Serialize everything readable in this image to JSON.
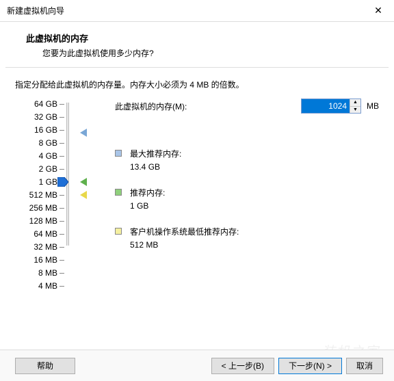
{
  "window": {
    "title": "新建虚拟机向导"
  },
  "header": {
    "title": "此虚拟机的内存",
    "subtitle": "您要为此虚拟机使用多少内存?"
  },
  "instruction": "指定分配给此虚拟机的内存量。内存大小必须为 4 MB 的倍数。",
  "memory": {
    "label": "此虚拟机的内存(M):",
    "value": "1024",
    "unit": "MB"
  },
  "scale": {
    "labels": [
      "64 GB",
      "32 GB",
      "16 GB",
      "8 GB",
      "4 GB",
      "2 GB",
      "1 GB",
      "512 MB",
      "256 MB",
      "128 MB",
      "64 MB",
      "32 MB",
      "16 MB",
      "8 MB",
      "4 MB"
    ]
  },
  "info": {
    "max_label": "最大推荐内存:",
    "max_value": "13.4 GB",
    "rec_label": "推荐内存:",
    "rec_value": "1 GB",
    "min_label": "客户机操作系统最低推荐内存:",
    "min_value": "512 MB"
  },
  "buttons": {
    "help": "帮助",
    "back": "< 上一步(B)",
    "next": "下一步(N) >",
    "cancel": "取消"
  },
  "watermark": "装机之家"
}
